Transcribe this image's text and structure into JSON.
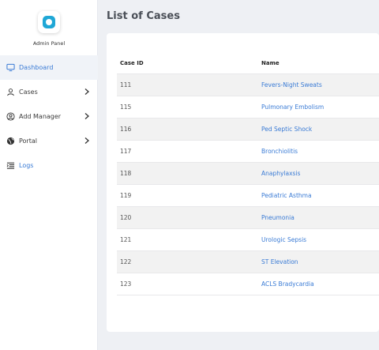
{
  "sidebar": {
    "logo_label": "Admin Panel",
    "items": [
      {
        "label": "Dashboard",
        "icon": "monitor-icon",
        "active": true
      },
      {
        "label": "Cases",
        "icon": "user-icon",
        "has_chevron": true
      },
      {
        "label": "Add Manager",
        "icon": "user-circle-icon",
        "has_chevron": true
      },
      {
        "label": "Portal",
        "icon": "globe-icon",
        "has_chevron": true
      },
      {
        "label": "Logs",
        "icon": "list-icon"
      }
    ]
  },
  "main": {
    "title": "List of Cases",
    "table": {
      "headers": [
        "Case ID",
        "Name"
      ],
      "rows": [
        {
          "id": "111",
          "name": "Fevers-Night Sweats"
        },
        {
          "id": "115",
          "name": "Pulmonary Embolism"
        },
        {
          "id": "116",
          "name": "Ped Septic Shock"
        },
        {
          "id": "117",
          "name": "Bronchiolitis"
        },
        {
          "id": "118",
          "name": "Anaphylaxsis"
        },
        {
          "id": "119",
          "name": "Pediatric Asthma"
        },
        {
          "id": "120",
          "name": "Pneumonia"
        },
        {
          "id": "121",
          "name": "Urologic Sepsis"
        },
        {
          "id": "122",
          "name": "ST Elevation"
        },
        {
          "id": "123",
          "name": "ACLS Bradycardia"
        }
      ]
    }
  },
  "colors": {
    "accent": "#3a7bd5",
    "logo": "#1fa7d6",
    "background": "#eef0f4",
    "stripe": "#f2f2f2"
  }
}
